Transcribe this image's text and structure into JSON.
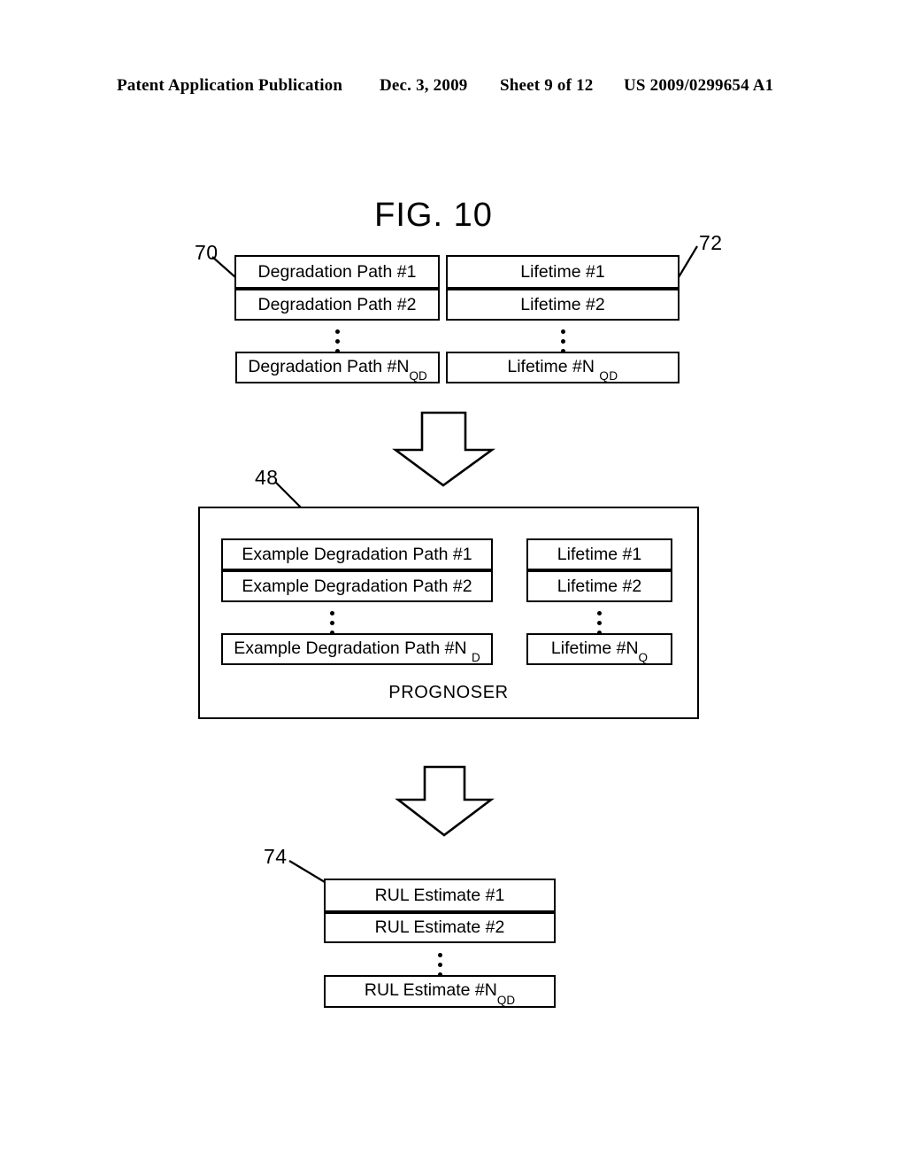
{
  "header": {
    "publication": "Patent Application Publication",
    "date": "Dec. 3, 2009",
    "sheet": "Sheet 9 of 12",
    "patent_number": "US 2009/0299654 A1"
  },
  "figure": {
    "title": "FIG. 10",
    "prognoser_label": "PROGNOSER"
  },
  "ref_numerals": {
    "input_degradation": "70",
    "input_lifetime": "72",
    "prognoser": "48",
    "output_rul": "74"
  },
  "input_block": {
    "degradation_column": [
      {
        "text": "Degradation Path #1",
        "sub": ""
      },
      {
        "text": "Degradation Path #2",
        "sub": ""
      },
      {
        "text": "Degradation Path #N",
        "sub": "QD"
      }
    ],
    "lifetime_column": [
      {
        "text": "Lifetime #1",
        "sub": ""
      },
      {
        "text": "Lifetime #2",
        "sub": ""
      },
      {
        "text": "Lifetime #N ",
        "sub": "QD"
      }
    ],
    "ellipsis": "⋮"
  },
  "prognoser_block": {
    "example_column": [
      {
        "text": "Example Degradation Path #1",
        "sub": ""
      },
      {
        "text": "Example Degradation Path #2",
        "sub": ""
      },
      {
        "text": "Example Degradation Path #N ",
        "sub": "D"
      }
    ],
    "lifetime_column": [
      {
        "text": "Lifetime #1",
        "sub": ""
      },
      {
        "text": "Lifetime #2",
        "sub": ""
      },
      {
        "text": "Lifetime #N",
        "sub": "Q"
      }
    ]
  },
  "output_block": {
    "rul_column": [
      {
        "text": "RUL Estimate #1",
        "sub": ""
      },
      {
        "text": "RUL Estimate #2",
        "sub": ""
      },
      {
        "text": "RUL Estimate  #N",
        "sub": "QD"
      }
    ]
  },
  "arrows": {
    "arrow_1_name": "down-arrow-to-prognoser",
    "arrow_2_name": "down-arrow-to-rul"
  },
  "colors": {
    "ink": "#000000",
    "paper": "#ffffff"
  }
}
